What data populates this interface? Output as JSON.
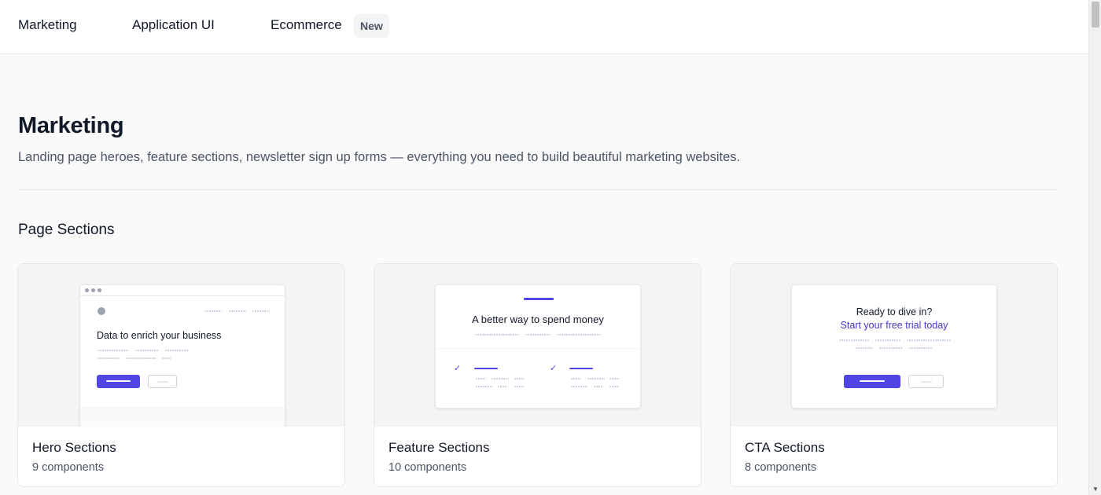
{
  "nav": {
    "items": [
      "Marketing",
      "Application UI",
      "Ecommerce"
    ],
    "badge": "New"
  },
  "page": {
    "title": "Marketing",
    "description": "Landing page heroes, feature sections, newsletter sign up forms — everything you need to build beautiful marketing websites."
  },
  "section": {
    "title": "Page Sections"
  },
  "cards": [
    {
      "title": "Hero Sections",
      "count": "9 components",
      "preview_heading": "Data to enrich your business"
    },
    {
      "title": "Feature Sections",
      "count": "10 components",
      "preview_heading": "A better way to spend money"
    },
    {
      "title": "CTA Sections",
      "count": "8 components",
      "preview_heading": "Ready to dive in?",
      "preview_subheading": "Start your free trial today"
    }
  ],
  "colors": {
    "accent": "#4f46e5",
    "text": "#111827",
    "muted": "#4b5563",
    "background": "#fafafb"
  },
  "icons": {
    "check": "check-icon",
    "scroll_up": "arrow-up-icon",
    "scroll_down": "arrow-down-icon"
  }
}
